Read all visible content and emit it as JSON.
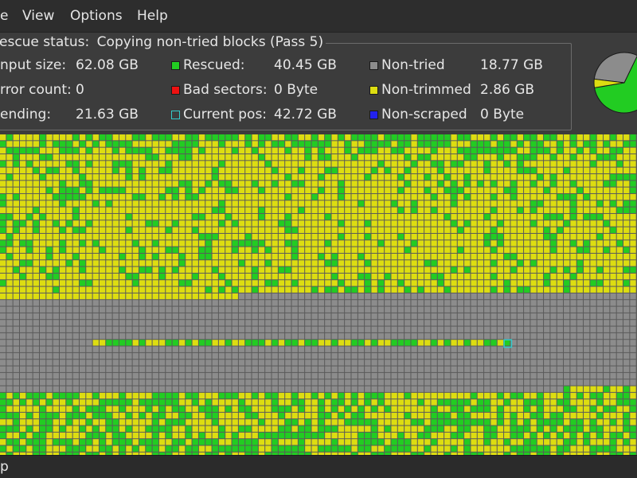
{
  "menu": [
    "e",
    "View",
    "Options",
    "Help"
  ],
  "status": {
    "title_label": "escue status:",
    "title_value": "Copying non-tried blocks (Pass 5)"
  },
  "stats": {
    "input_size_label": "nput size:",
    "input_size_value": "62.08 GB",
    "error_count_label": "rror count:",
    "error_count_value": "0",
    "pending_label": "ending:",
    "pending_value": "21.63 GB",
    "rescued_label": "Rescued:",
    "rescued_value": "40.45 GB",
    "bad_sectors_label": "Bad sectors:",
    "bad_sectors_value": "0 Byte",
    "current_pos_label": "Current pos:",
    "current_pos_value": "42.72 GB",
    "non_tried_label": "Non-tried",
    "non_tried_value": "18.77 GB",
    "non_trimmed_label": "Non-trimmed",
    "non_trimmed_value": "2.86 GB",
    "non_scraped_label": "Non-scraped",
    "non_scraped_value": "0 Byte"
  },
  "colors": {
    "rescued": "#22cc22",
    "bad_sectors": "#ee1111",
    "current_pos": "#33cccc",
    "non_tried": "#8c8c8c",
    "non_trimmed": "#dddd11",
    "non_scraped": "#2222ee"
  },
  "pie": {
    "rescued_fraction": 0.6516,
    "non_tried_fraction": 0.3024,
    "non_trimmed_fraction": 0.046
  },
  "block_map": {
    "current_pos_fraction": 0.688
  },
  "statusbar": {
    "text": "p"
  }
}
